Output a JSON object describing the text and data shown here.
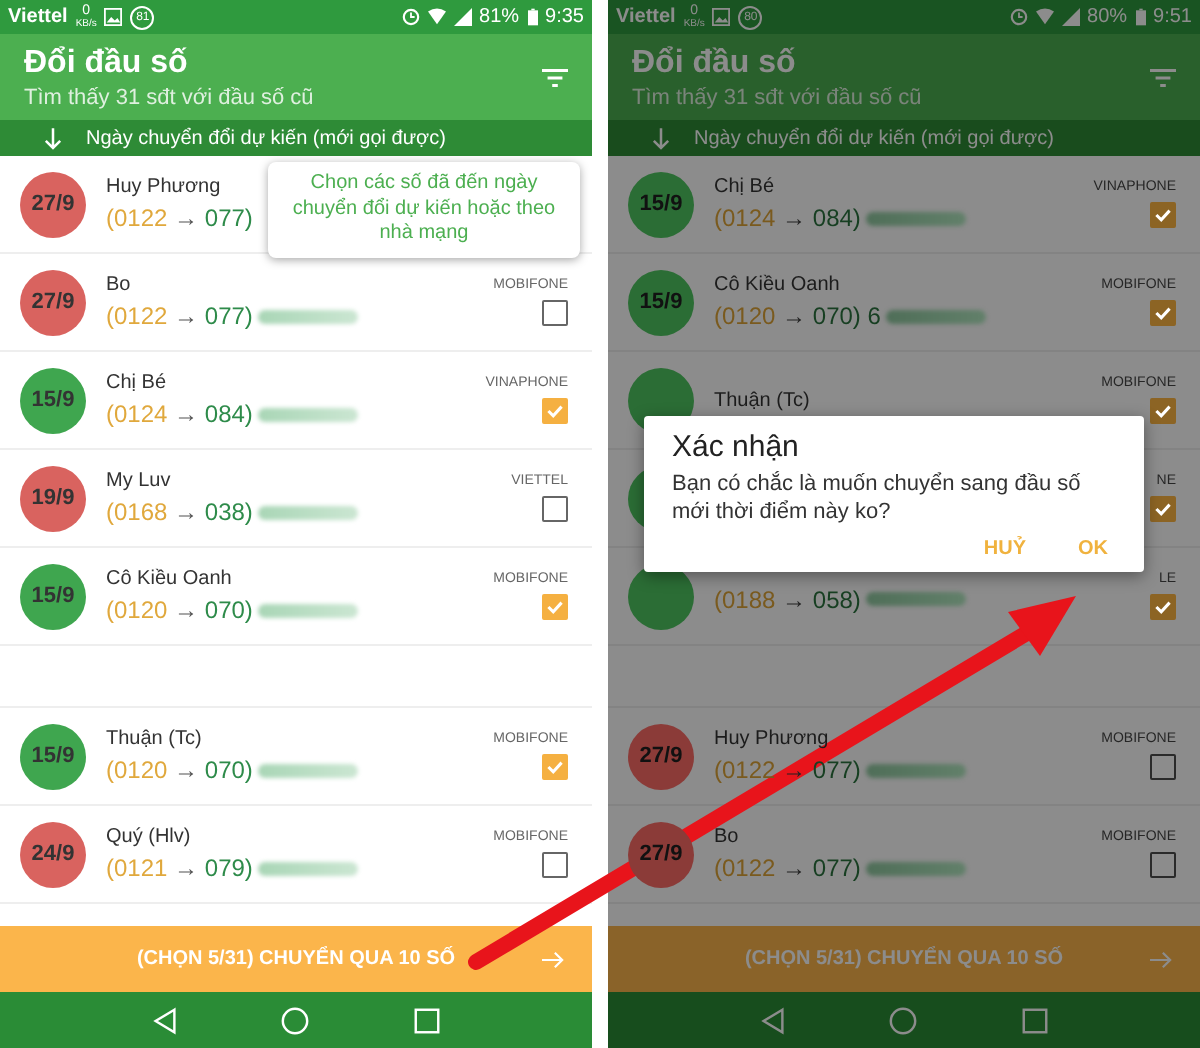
{
  "phones": [
    {
      "dimmed": false,
      "status_bar": {
        "carrier": "Viettel",
        "speed": "0",
        "speed_unit": "KB/s",
        "badge": "81",
        "battery": "81%",
        "time": "9:35"
      },
      "header": {
        "title": "Đổi đầu số",
        "subtitle": "Tìm thấy 31 sđt với đầu số cũ"
      },
      "sort_bar": {
        "label": "Ngày chuyển đổi dự kiến (mới gọi được)"
      },
      "tooltip": {
        "text": "Chọn các số đã đến ngày chuyển đổi dự kiến hoặc theo nhà mạng"
      },
      "contacts": [
        {
          "kind": "contact",
          "date": "27/9",
          "color": "#d9635f",
          "name": "Huy Phương",
          "old": "(0122",
          "arrow": "→",
          "new": "077)"
        },
        {
          "kind": "contact",
          "date": "27/9",
          "color": "#d9635f",
          "name": "Bo",
          "old": "(0122",
          "arrow": "→",
          "new": "077)",
          "carrier": "MOBIFONE",
          "checked": false
        },
        {
          "kind": "contact",
          "date": "15/9",
          "color": "#3fa64f",
          "name": "Chị Bé",
          "old": "(0124",
          "arrow": "→",
          "new": "084)",
          "carrier": "VINAPHONE",
          "checked": true
        },
        {
          "kind": "contact",
          "date": "19/9",
          "color": "#d9635f",
          "name": "My Luv",
          "old": "(0168",
          "arrow": "→",
          "new": "038)",
          "carrier": "VIETTEL",
          "checked": false
        },
        {
          "kind": "contact",
          "date": "15/9",
          "color": "#3fa64f",
          "name": "Cô Kiều Oanh",
          "old": "(0120",
          "arrow": "→",
          "new": "070)",
          "carrier": "MOBIFONE",
          "checked": true
        },
        {
          "kind": "spacer"
        },
        {
          "kind": "contact",
          "date": "15/9",
          "color": "#3fa64f",
          "name": "Thuận (Tc)",
          "old": "(0120",
          "arrow": "→",
          "new": "070)",
          "carrier": "MOBIFONE",
          "checked": true
        },
        {
          "kind": "contact",
          "date": "24/9",
          "color": "#d9635f",
          "name": "Quý (Hlv)",
          "old": "(0121",
          "arrow": "→",
          "new": "079)",
          "carrier": "MOBIFONE",
          "checked": false
        }
      ],
      "action_bar": {
        "label": "(CHỌN 5/31) CHUYỂN QUA 10 SỐ"
      }
    },
    {
      "dimmed": true,
      "status_bar": {
        "carrier": "Viettel",
        "speed": "0",
        "speed_unit": "KB/s",
        "badge": "80",
        "battery": "80%",
        "time": "9:51"
      },
      "header": {
        "title": "Đổi đầu số",
        "subtitle": "Tìm thấy 31 sđt với đầu số cũ"
      },
      "sort_bar": {
        "label": "Ngày chuyển đổi dự kiến (mới gọi được)"
      },
      "contacts": [
        {
          "kind": "contact",
          "date": "15/9",
          "color": "#2b6d35",
          "name": "Chị Bé",
          "old": "(0124",
          "arrow": "→",
          "new": "084)",
          "carrier": "VINAPHONE",
          "checked": true
        },
        {
          "kind": "contact",
          "date": "15/9",
          "color": "#2b6d35",
          "name": "Cô Kiều Oanh",
          "old": "(0120",
          "arrow": "→",
          "new": "070) 6",
          "carrier": "MOBIFONE",
          "checked": true
        },
        {
          "kind": "contact",
          "color": "#2b6d35",
          "name": "Thuận (Tc)",
          "carrier": "MOBIFONE",
          "checked": true
        },
        {
          "kind": "contact",
          "color": "#2b6d35",
          "carrier": "NE",
          "checked": true
        },
        {
          "kind": "contact",
          "color": "#2b6d35",
          "old": "(0188",
          "arrow": "→",
          "new": "058)",
          "carrier": "LE",
          "checked": true
        },
        {
          "kind": "spacer"
        },
        {
          "kind": "contact",
          "date": "27/9",
          "color": "#8b3b38",
          "name": "Huy Phương",
          "old": "(0122",
          "arrow": "→",
          "new": "077)",
          "carrier": "MOBIFONE",
          "checked": false
        },
        {
          "kind": "contact",
          "date": "27/9",
          "color": "#8b3b38",
          "name": "Bo",
          "old": "(0122",
          "arrow": "→",
          "new": "077)",
          "carrier": "MOBIFONE",
          "checked": false
        }
      ],
      "action_bar": {
        "label": "(CHỌN 5/31) CHUYỂN QUA 10 SỐ"
      },
      "dialog": {
        "title": "Xác nhận",
        "message": "Bạn có chắc là muốn chuyển sang đầu số mới thời điểm này ko?",
        "buttons": [
          "HUỶ",
          "OK"
        ]
      }
    }
  ]
}
